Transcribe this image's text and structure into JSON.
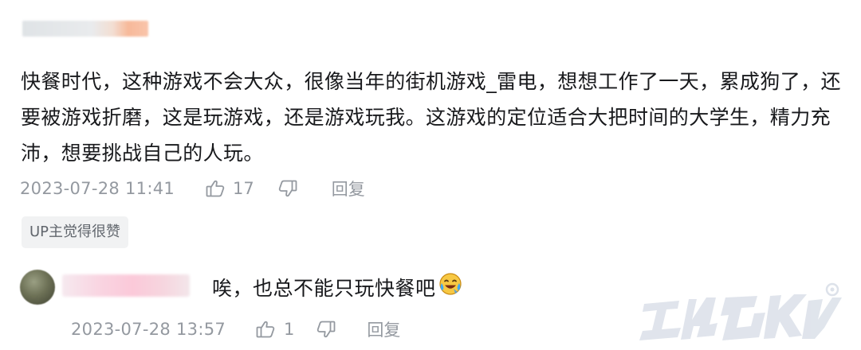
{
  "comment1": {
    "text": "快餐时代，这种游戏不会大众，很像当年的街机游戏_雷电，想想工作了一天，累成狗了，还要被游戏折磨，这是玩游戏，还是游戏玩我。这游戏的定位适合大把时间的大学生，精力充沛，想要挑战自己的人玩。",
    "date": "2023-07-28 11:41",
    "likes": "17",
    "reply_label": "回复",
    "badge": "UP主觉得很赞"
  },
  "reply1": {
    "text": "唉，也总不能只玩快餐吧",
    "emoji": "crying-laughing-emoji",
    "date": "2023-07-28 13:57",
    "likes": "1",
    "reply_label": "回复"
  },
  "colors": {
    "text_primary": "#18191c",
    "text_meta": "#9499a0",
    "badge_bg": "#f1f2f3",
    "watermark": "#dde2ea"
  },
  "icons": [
    "thumbs-up-icon",
    "thumbs-down-icon",
    "crying-laughing-emoji",
    "watermark-logo"
  ]
}
